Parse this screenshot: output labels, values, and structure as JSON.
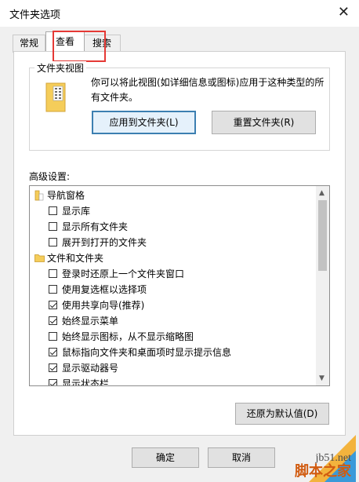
{
  "window": {
    "title": "文件夹选项",
    "close_glyph": "✕"
  },
  "tabs": [
    {
      "label": "常规"
    },
    {
      "label": "查看"
    },
    {
      "label": "搜索"
    }
  ],
  "folder_views": {
    "title": "文件夹视图",
    "description": "你可以将此视图(如详细信息或图标)应用于这种类型的所有文件夹。",
    "apply_button": "应用到文件夹(L)",
    "reset_button": "重置文件夹(R)"
  },
  "advanced": {
    "label": "高级设置:",
    "items": [
      {
        "label": "导航窗格",
        "type": "group-nav",
        "checked": false
      },
      {
        "label": "显示库",
        "type": "checkbox",
        "checked": false
      },
      {
        "label": "显示所有文件夹",
        "type": "checkbox",
        "checked": false
      },
      {
        "label": "展开到打开的文件夹",
        "type": "checkbox",
        "checked": false
      },
      {
        "label": "文件和文件夹",
        "type": "group-folder",
        "checked": false
      },
      {
        "label": "登录时还原上一个文件夹窗口",
        "type": "checkbox",
        "checked": false
      },
      {
        "label": "使用复选框以选择项",
        "type": "checkbox",
        "checked": false
      },
      {
        "label": "使用共享向导(推荐)",
        "type": "checkbox",
        "checked": true
      },
      {
        "label": "始终显示菜单",
        "type": "checkbox",
        "checked": true
      },
      {
        "label": "始终显示图标，从不显示缩略图",
        "type": "checkbox",
        "checked": false
      },
      {
        "label": "鼠标指向文件夹和桌面项时显示提示信息",
        "type": "checkbox",
        "checked": true
      },
      {
        "label": "显示驱动器号",
        "type": "checkbox",
        "checked": true
      },
      {
        "label": "显示状态栏",
        "type": "checkbox",
        "checked": true
      }
    ],
    "restore_button": "还原为默认值(D)"
  },
  "footer": {
    "ok_button": "确定",
    "cancel_button": "取消"
  },
  "watermark": {
    "url": "jb51.net",
    "text": "脚本之家"
  },
  "colors": {
    "highlight_border": "#e53935",
    "accent": "#3c7fb1",
    "folder_yellow": "#f5cd5a"
  }
}
